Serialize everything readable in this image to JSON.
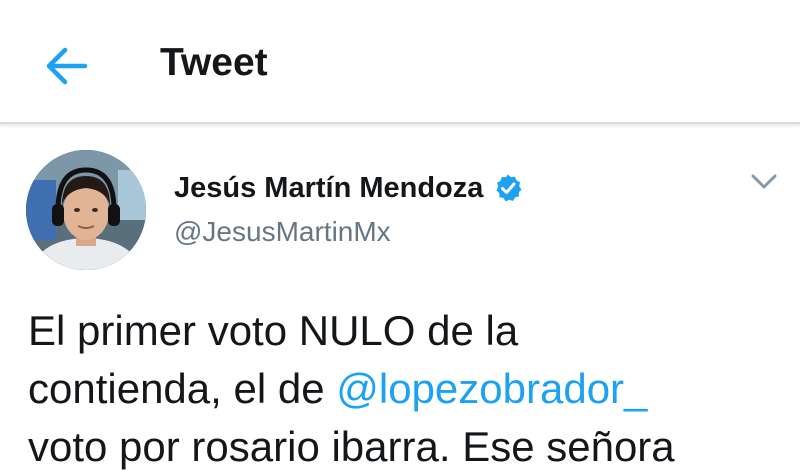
{
  "header": {
    "back_icon": "arrow-left-icon",
    "title": "Tweet",
    "accent": "#1da1f2"
  },
  "tweet": {
    "author": {
      "name": "Jesús Martín Mendoza",
      "handle": "@JesusMartinMx",
      "verified": true,
      "verified_icon": "verified-badge-icon",
      "avatar": "avatar-photo"
    },
    "menu_icon": "chevron-down-icon",
    "text": {
      "line1": "El primer voto NULO de la",
      "line2_prefix": "contienda, el de ",
      "mention": "@lopezobrador_",
      "line3": "voto por rosario ibarra. Ese señora"
    }
  },
  "colors": {
    "text": "#14171a",
    "secondary": "#657786",
    "link": "#1da1f2",
    "divider": "#d9dde0"
  }
}
